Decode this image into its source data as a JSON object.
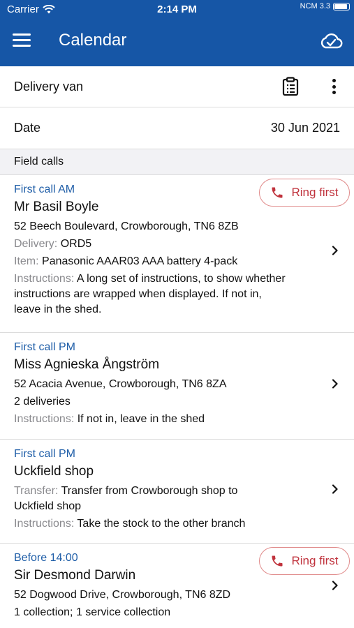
{
  "status_bar": {
    "carrier": "Carrier",
    "time": "2:14 PM",
    "battery_text": "NCM 3.3"
  },
  "header": {
    "title": "Calendar",
    "menu_icon": "hamburger-icon",
    "sync_icon": "cloud-check-icon"
  },
  "vehicle": {
    "label": "Delivery van",
    "clipboard_icon": "clipboard-icon",
    "more_icon": "more-vertical-icon"
  },
  "date": {
    "label": "Date",
    "value": "30 Jun 2021"
  },
  "section": {
    "title": "Field calls"
  },
  "ring_first_label": "Ring first",
  "colors": {
    "brand": "#1656a6",
    "link": "#1f5ea8",
    "alert": "#c0333d"
  },
  "calls": [
    {
      "time": "First call AM",
      "name": "Mr Basil Boyle",
      "address": "52 Beech Boulevard, Crowborough, TN6 8ZB",
      "delivery_key": "Delivery:",
      "delivery_value": "ORD5",
      "item_key": "Item:",
      "item_value": "Panasonic AAAR03 AAA battery 4-pack",
      "instructions_key": "Instructions:",
      "instructions_value": "A long set of instructions, to show whether instructions are wrapped when displayed. If not in, leave in the shed."
    },
    {
      "time": "First call PM",
      "name": "Miss Agnieska Ångström",
      "address": "52 Acacia Avenue, Crowborough, TN6 8ZA",
      "summary": "2 deliveries",
      "instructions_key": "Instructions:",
      "instructions_value": "If not in, leave in the shed"
    },
    {
      "time": "First call PM",
      "name": "Uckfield shop",
      "transfer_key": "Transfer:",
      "transfer_value": "Transfer from Crowborough shop to Uckfield shop",
      "instructions_key": "Instructions:",
      "instructions_value": "Take the stock to the other branch"
    },
    {
      "time": "Before 14:00",
      "name": "Sir Desmond Darwin",
      "address": "52 Dogwood Drive, Crowborough, TN6 8ZD",
      "summary": "1 collection; 1 service collection"
    }
  ]
}
